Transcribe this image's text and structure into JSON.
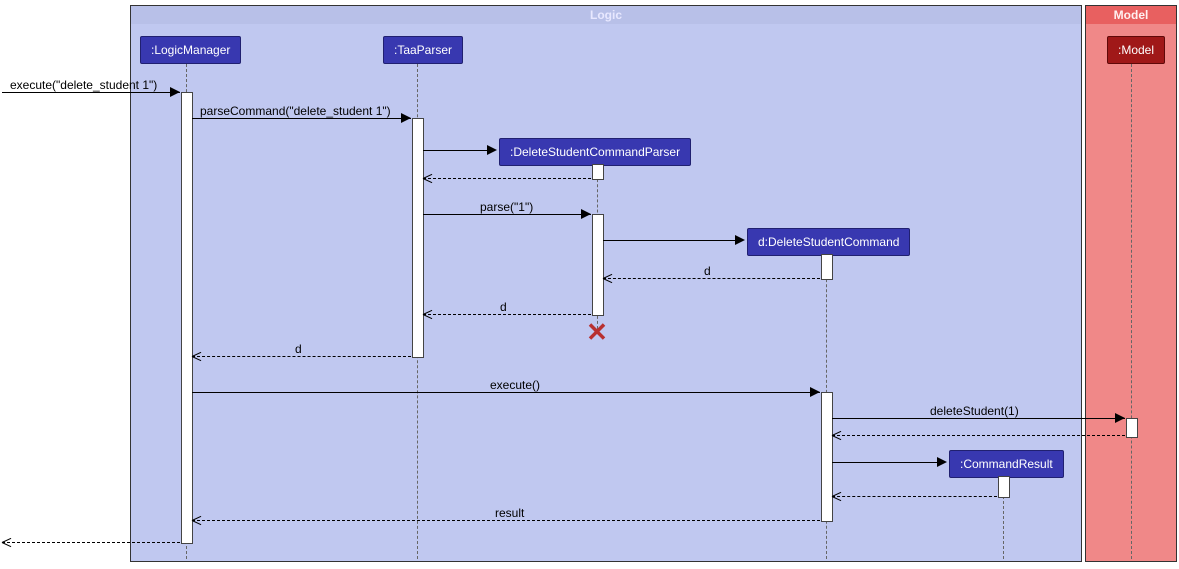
{
  "frames": {
    "logic": {
      "label": "Logic"
    },
    "model": {
      "label": "Model"
    }
  },
  "participants": {
    "logicManager": ":LogicManager",
    "taaParser": ":TaaParser",
    "deleteStudentCommandParser": ":DeleteStudentCommandParser",
    "deleteStudentCommand": "d:DeleteStudentCommand",
    "commandResult": ":CommandResult",
    "model": ":Model"
  },
  "messages": {
    "execute_in": "execute(\"delete_student 1\")",
    "parseCommand": "parseCommand(\"delete_student 1\")",
    "parse": "parse(\"1\")",
    "return_d1": "d",
    "return_d2": "d",
    "return_d3": "d",
    "execute": "execute()",
    "deleteStudent": "deleteStudent(1)",
    "result": "result"
  },
  "chart_data": {
    "type": "sequence_diagram",
    "frames": [
      {
        "name": "Logic",
        "participants": [
          "LogicManager",
          "TaaParser",
          "DeleteStudentCommandParser",
          "d:DeleteStudentCommand",
          "CommandResult"
        ]
      },
      {
        "name": "Model",
        "participants": [
          "Model"
        ]
      }
    ],
    "participants": [
      {
        "id": "ext",
        "name": "(external caller)"
      },
      {
        "id": "lm",
        "name": ":LogicManager"
      },
      {
        "id": "tp",
        "name": ":TaaParser"
      },
      {
        "id": "dscp",
        "name": ":DeleteStudentCommandParser"
      },
      {
        "id": "dsc",
        "name": "d:DeleteStudentCommand"
      },
      {
        "id": "cr",
        "name": ":CommandResult"
      },
      {
        "id": "mdl",
        "name": ":Model"
      }
    ],
    "interactions": [
      {
        "from": "ext",
        "to": "lm",
        "label": "execute(\"delete_student 1\")",
        "type": "sync"
      },
      {
        "from": "lm",
        "to": "tp",
        "label": "parseCommand(\"delete_student 1\")",
        "type": "sync"
      },
      {
        "from": "tp",
        "to": "dscp",
        "label": "",
        "type": "create"
      },
      {
        "from": "dscp",
        "to": "tp",
        "label": "",
        "type": "return"
      },
      {
        "from": "tp",
        "to": "dscp",
        "label": "parse(\"1\")",
        "type": "sync"
      },
      {
        "from": "dscp",
        "to": "dsc",
        "label": "",
        "type": "create"
      },
      {
        "from": "dsc",
        "to": "dscp",
        "label": "d",
        "type": "return"
      },
      {
        "from": "dscp",
        "to": "tp",
        "label": "d",
        "type": "return"
      },
      {
        "from": "dscp",
        "to": null,
        "label": "",
        "type": "destroy"
      },
      {
        "from": "tp",
        "to": "lm",
        "label": "d",
        "type": "return"
      },
      {
        "from": "lm",
        "to": "dsc",
        "label": "execute()",
        "type": "sync"
      },
      {
        "from": "dsc",
        "to": "mdl",
        "label": "deleteStudent(1)",
        "type": "sync"
      },
      {
        "from": "mdl",
        "to": "dsc",
        "label": "",
        "type": "return"
      },
      {
        "from": "dsc",
        "to": "cr",
        "label": "",
        "type": "create"
      },
      {
        "from": "cr",
        "to": "dsc",
        "label": "",
        "type": "return"
      },
      {
        "from": "dsc",
        "to": "lm",
        "label": "result",
        "type": "return"
      },
      {
        "from": "lm",
        "to": "ext",
        "label": "",
        "type": "return"
      }
    ]
  }
}
